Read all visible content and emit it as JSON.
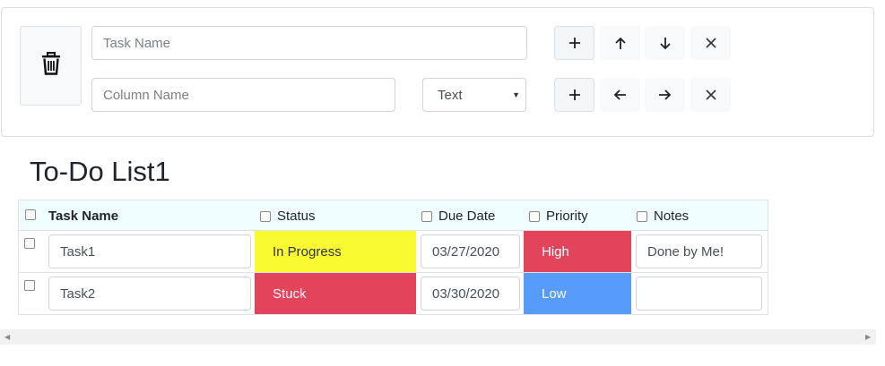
{
  "toolbar": {
    "task_name_placeholder": "Task Name",
    "column_name_placeholder": "Column Name",
    "column_type": "Text",
    "icons": [
      "trash-icon",
      "plus-icon",
      "arrow-up-icon",
      "arrow-down-icon",
      "close-icon",
      "plus-icon",
      "arrow-left-icon",
      "arrow-right-icon",
      "close-icon"
    ]
  },
  "list": {
    "title": "To-Do List1",
    "headers": {
      "task_name": "Task Name",
      "status": "Status",
      "due_date": "Due Date",
      "priority": "Priority",
      "notes": "Notes"
    },
    "rows": [
      {
        "task": "Task1",
        "status": "In Progress",
        "due": "03/27/2020",
        "priority": "High",
        "notes": "Done by Me!"
      },
      {
        "task": "Task2",
        "status": "Stuck",
        "due": "03/30/2020",
        "priority": "Low",
        "notes": ""
      }
    ]
  },
  "colors": {
    "in_progress": "#fafa32",
    "stuck": "#e2445c",
    "high": "#e2445c",
    "low": "#579bfc",
    "header_bg": "#f0fdfe"
  }
}
